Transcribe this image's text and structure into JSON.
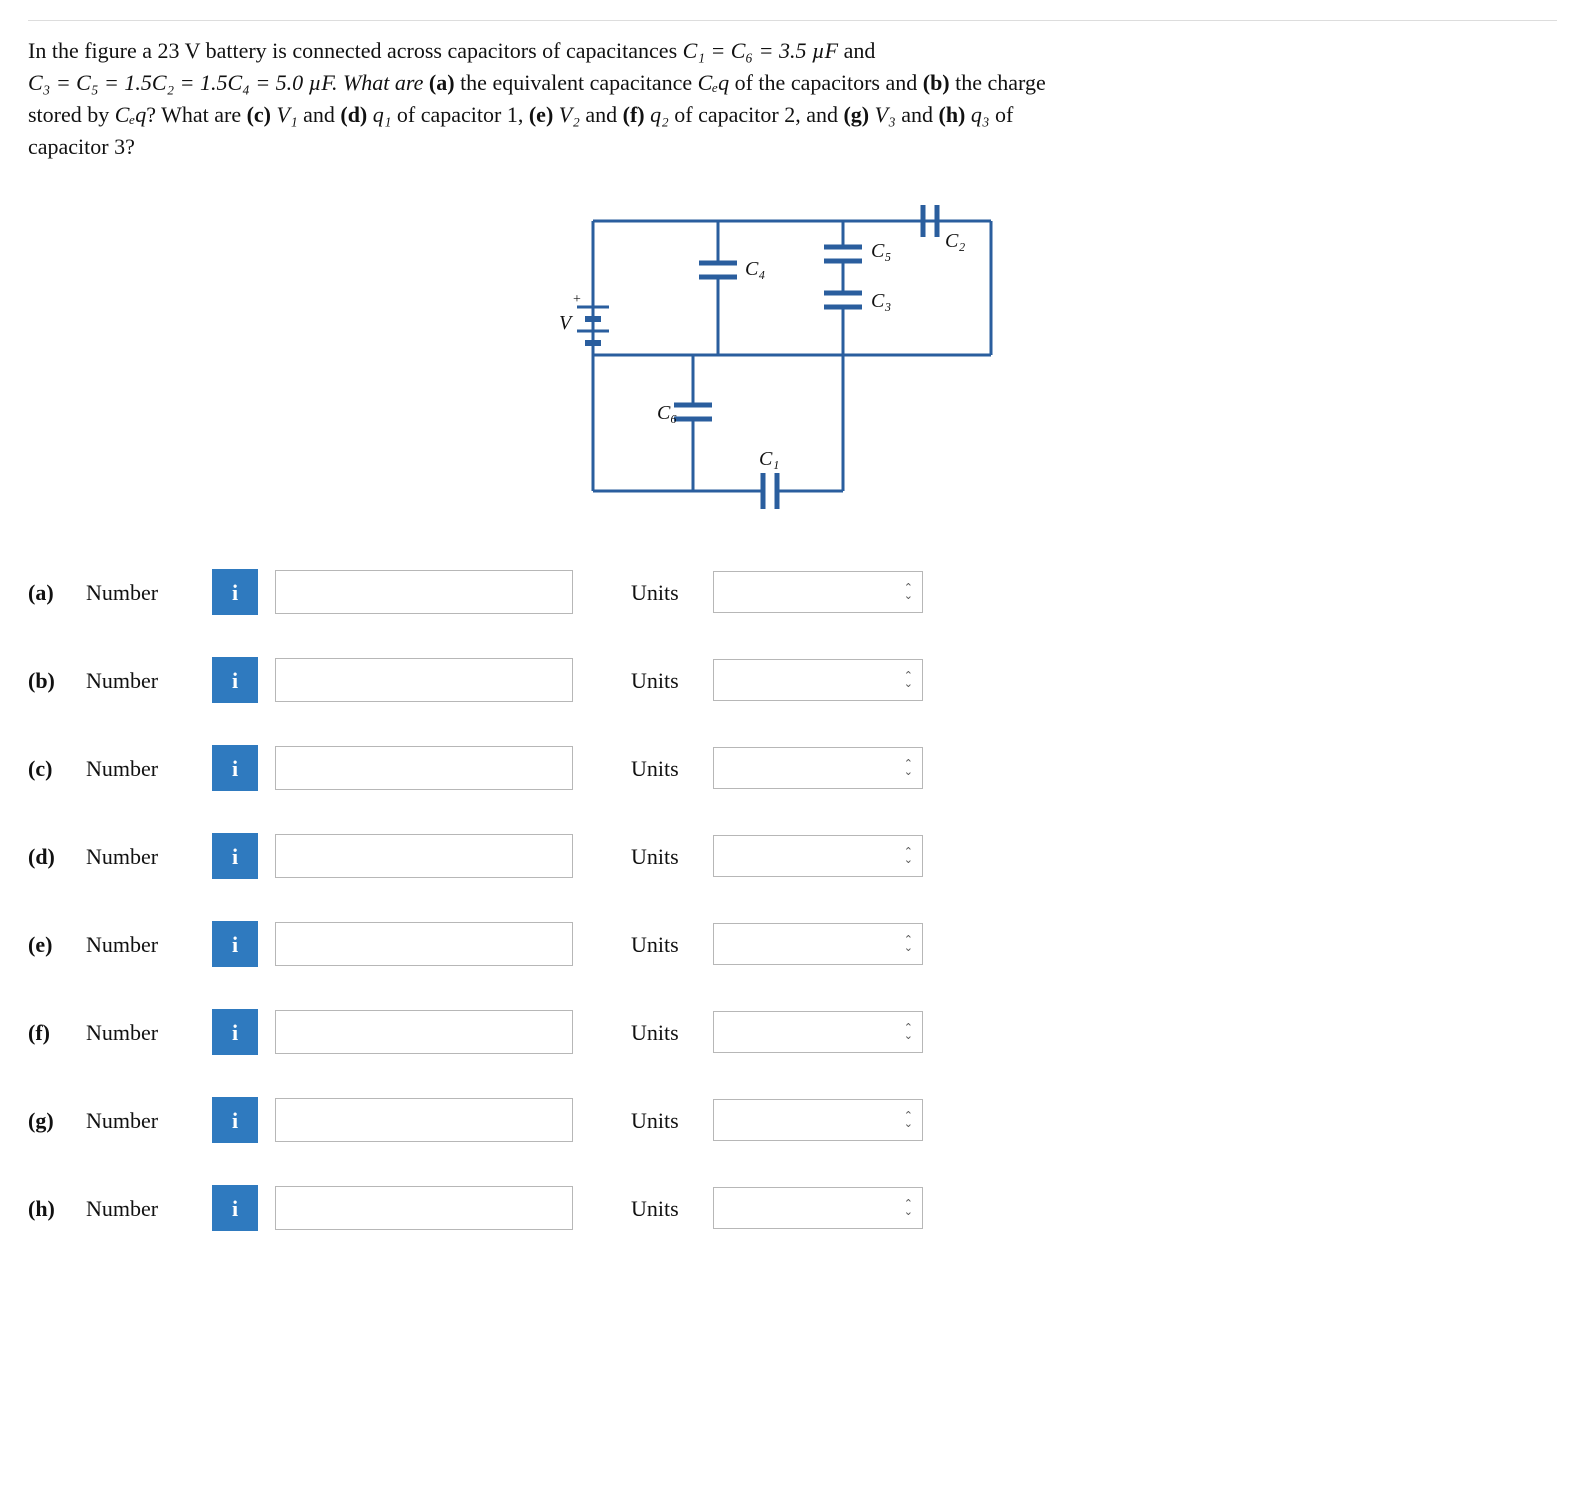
{
  "problem": {
    "line1_pre": "In the figure a ",
    "voltage": "23 V",
    "line1_mid": " battery is connected across capacitors of capacitances ",
    "c1c6": "C₁ = C₆ = 3.5 µF",
    "line1_post": " and",
    "line2_pre": "C₃ = C₅ = 1.5C₂ = 1.5C₄ = 5.0 µF. What are ",
    "part_a_lbl": "(a)",
    "line2_a": " the equivalent capacitance ",
    "ceq": "Cₑq",
    "line2_a2": " of the capacitors and ",
    "part_b_lbl": "(b)",
    "line2_b": " the charge",
    "line3_pre": "stored by ",
    "line3_ceq": "Cₑq",
    "line3_q": "? What are ",
    "part_c_lbl": "(c)",
    "v1": " V₁ ",
    "and1": "and ",
    "part_d_lbl": "(d)",
    "q1": " q₁ ",
    "cap1": "of capacitor 1, ",
    "part_e_lbl": "(e)",
    "v2": " V₂ ",
    "and2": "and ",
    "part_f_lbl": "(f)",
    "q2": " q₂ ",
    "cap2": "of capacitor 2, and ",
    "part_g_lbl": "(g)",
    "v3": " V₃ ",
    "and3": "and ",
    "part_h_lbl": "(h)",
    "q3": " q₃ ",
    "cap3": "of",
    "line4": "capacitor 3?"
  },
  "diagram": {
    "V": "V",
    "C1": "C₁",
    "C2": "C₂",
    "C3": "C₃",
    "C4": "C₄",
    "C5": "C₅",
    "C6": "C₆"
  },
  "labels": {
    "number": "Number",
    "units": "Units",
    "info": "i"
  },
  "parts": [
    {
      "id": "(a)"
    },
    {
      "id": "(b)"
    },
    {
      "id": "(c)"
    },
    {
      "id": "(d)"
    },
    {
      "id": "(e)"
    },
    {
      "id": "(f)"
    },
    {
      "id": "(g)"
    },
    {
      "id": "(h)"
    }
  ]
}
